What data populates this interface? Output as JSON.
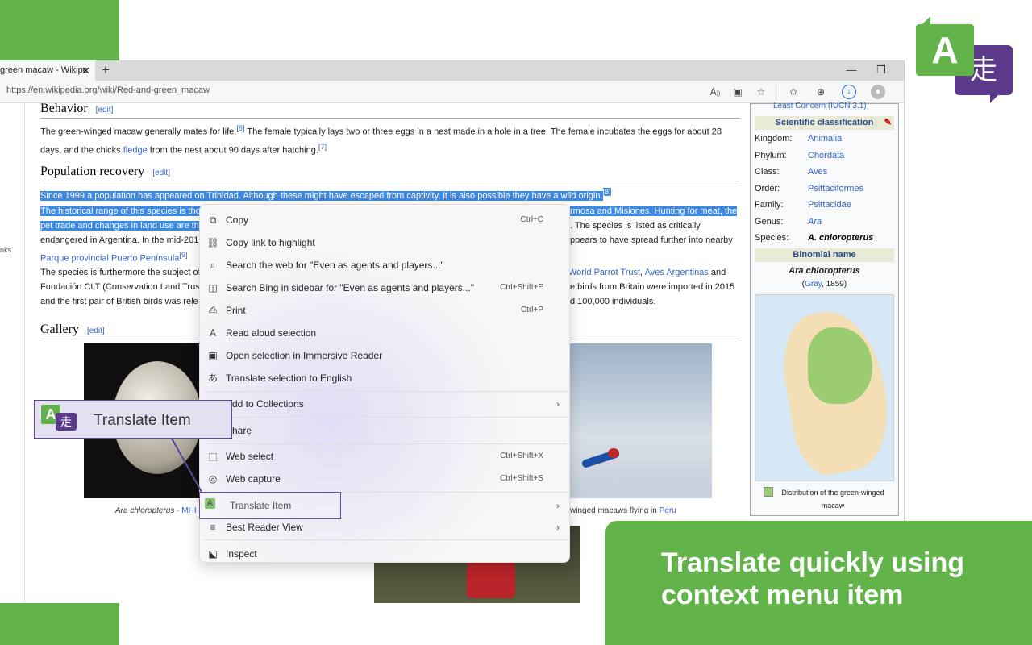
{
  "browser": {
    "tab_title": "green macaw - Wikipe",
    "tab_close": "✕",
    "new_tab": "+",
    "minimize": "—",
    "restore": "❐",
    "url": "https://en.wikipedia.org/wiki/Red-and-green_macaw"
  },
  "toolbar_icons": [
    "read-aloud-icon",
    "immersive-reader-icon",
    "add-favorite-icon",
    "favorites-icon",
    "collections-icon",
    "downloads-icon",
    "profile-icon"
  ],
  "page": {
    "sidebar_fragment": "nks",
    "behavior_heading": "Behavior",
    "edit": "edit",
    "behavior_text_1": "The green-winged macaw generally mates for life.",
    "ref6": "[6]",
    "behavior_text_2": " The female typically lays two or three eggs in a nest made in a hole in a tree. The female incubates the eggs for about 28 days, and the chicks ",
    "fledge": "fledge",
    "behavior_text_3": " from the nest about 90 days after hatching.",
    "ref7": "[7]",
    "pop_heading": "Population recovery",
    "pop_sel": "Since 1999 a population has appeared on Trinidad. Although these might have escaped from captivity, it is also possible they have a wild origin.",
    "ref8": "[8]",
    "pop2_sel_a": "The historical range of this species is tho",
    "pop2_sel_b": "rmosa and Misiones. Hunting for meat, the",
    "pop2_sel_c": "pet trade and changes in land use are th",
    "pop2_right": ". The species is listed as critically",
    "pop2_line3a": "endangered in Argentina. In the mid-201",
    "pop2_line3b": "ppears to have spread further into nearby",
    "parque": "Parque provincial Puerto Península",
    "ref9": "[9]",
    "p3_a": "The species is furthermore the subject of",
    "p3_wpt": "World Parrot Trust",
    "p3_comma": ", ",
    "p3_aves": "Aves Argentinas",
    "p3_and": " and",
    "p3_line2a": "Fundación CLT (Conservation Land Trus",
    "p3_line2b": "e birds from Britain were imported in 2015",
    "p3_line3a": "and the first pair of British birds was rele",
    "p3_line3b": "d 100,000 individuals.",
    "gallery_heading": "Gallery",
    "caption_left_a": "Ara chloropterus",
    "caption_left_b": " - MHI",
    "caption_right_a": "winged macaws flying in ",
    "caption_right_peru": "Peru"
  },
  "infobox": {
    "top_partial": "Least Concern (IUCN 3.1)",
    "sci_head": "Scientific classification",
    "rows": [
      {
        "label": "Kingdom:",
        "value": "Animalia"
      },
      {
        "label": "Phylum:",
        "value": "Chordata"
      },
      {
        "label": "Class:",
        "value": "Aves"
      },
      {
        "label": "Order:",
        "value": "Psittaciformes"
      },
      {
        "label": "Family:",
        "value": "Psittacidae"
      },
      {
        "label": "Genus:",
        "value": "Ara"
      },
      {
        "label": "Species:",
        "value": "A. chloropterus"
      }
    ],
    "binomial_head": "Binomial name",
    "binomial": "Ara chloropterus",
    "author_a": "(",
    "author_gray": "Gray",
    "author_b": ", 1859)",
    "legend": "Distribution of the green-winged macaw"
  },
  "context_menu": {
    "items": [
      {
        "icon": "copy-icon",
        "glyph": "⧉",
        "label": "Copy",
        "shortcut": "Ctrl+C"
      },
      {
        "icon": "copy-link-icon",
        "glyph": "⛓",
        "label": "Copy link to highlight",
        "shortcut": ""
      },
      {
        "icon": "search-icon",
        "glyph": "⌕",
        "label": "Search the web for \"Even as agents and players...\"",
        "shortcut": ""
      },
      {
        "icon": "sidebar-search-icon",
        "glyph": "◫",
        "label": "Search Bing in sidebar for \"Even as agents and players...\"",
        "shortcut": "Ctrl+Shift+E"
      },
      {
        "icon": "print-icon",
        "glyph": "⎙",
        "label": "Print",
        "shortcut": "Ctrl+P"
      },
      {
        "icon": "read-aloud-icon",
        "glyph": "A",
        "label": "Read aloud selection",
        "shortcut": ""
      },
      {
        "icon": "immersive-reader-icon",
        "glyph": "▣",
        "label": "Open selection in Immersive Reader",
        "shortcut": ""
      },
      {
        "icon": "translate-icon",
        "glyph": "あ",
        "label": "Translate selection to English",
        "shortcut": ""
      },
      {
        "icon": "collections-icon",
        "glyph": "⊞",
        "label": "Add to Collections",
        "shortcut": ""
      },
      {
        "icon": "share-icon",
        "glyph": "↗",
        "label": "Share",
        "shortcut": ""
      },
      {
        "icon": "web-select-icon",
        "glyph": "⬚",
        "label": "Web select",
        "shortcut": "Ctrl+Shift+X"
      },
      {
        "icon": "web-capture-icon",
        "glyph": "◎",
        "label": "Web capture",
        "shortcut": "Ctrl+Shift+S"
      },
      {
        "icon": "translate-item-icon",
        "glyph": "A",
        "label": "Translate Item",
        "shortcut": ""
      },
      {
        "icon": "reader-view-icon",
        "glyph": "≡",
        "label": "Best Reader View",
        "shortcut": ""
      },
      {
        "icon": "inspect-icon",
        "glyph": "⬕",
        "label": "Inspect",
        "shortcut": ""
      }
    ],
    "submenu_arrow": "›"
  },
  "callout": {
    "label": "Translate Item"
  },
  "logo": {
    "latin": "A",
    "kanji": "走"
  },
  "banner": {
    "text": "Translate quickly using context menu item"
  },
  "colors": {
    "green": "#62b44a",
    "purple": "#5b3a8c",
    "selection": "#3c88e5",
    "link": "#3366cc"
  }
}
